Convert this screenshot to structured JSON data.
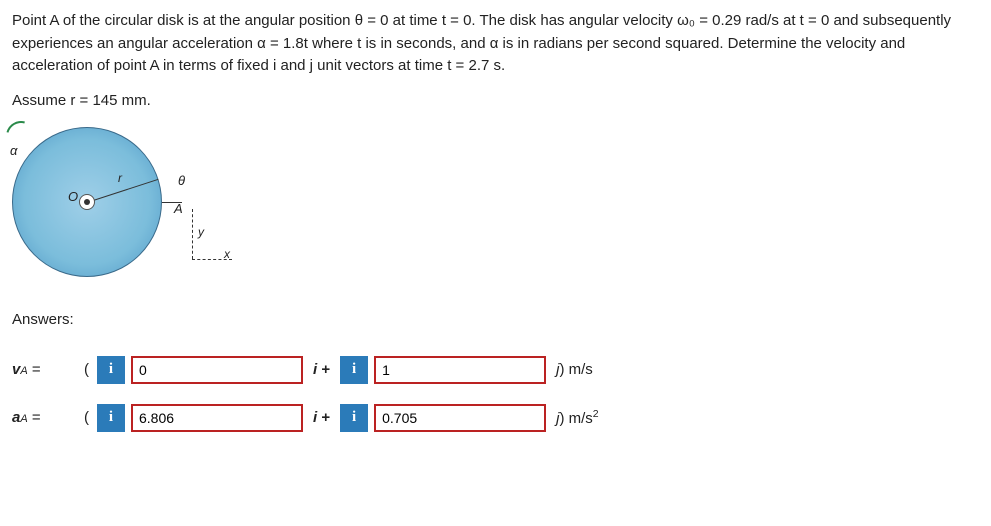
{
  "question": {
    "body": "Point A of the circular disk is at the angular position θ = 0 at time t = 0. The disk has angular velocity ω₀ = 0.29 rad/s at t = 0 and subsequently experiences an angular acceleration α = 1.8t where t is in seconds, and α is in radians per second squared. Determine the velocity and acceleration of point A in terms of fixed i and j unit vectors at time t = 2.7 s.",
    "assume": "Assume r = 145 mm."
  },
  "diagram": {
    "alpha_label": "α",
    "o_label": "O",
    "r_label": "r",
    "theta_label": "θ",
    "a_label": "A",
    "y_label": "y",
    "x_label": "x"
  },
  "answers_header": "Answers:",
  "rows": {
    "vA": {
      "symbol_main": "v",
      "symbol_sub": "A",
      "equals": "=",
      "lparen": "(",
      "info": "i",
      "i_value": "0",
      "i_unit": "i +",
      "j_value": "1",
      "j_unit": "j) m/s"
    },
    "aA": {
      "symbol_main": "a",
      "symbol_sub": "A",
      "equals": "=",
      "lparen": "(",
      "info": "i",
      "i_value": "6.806",
      "i_unit": "i +",
      "j_value": "0.705",
      "j_unit": "j) m/s²"
    }
  }
}
